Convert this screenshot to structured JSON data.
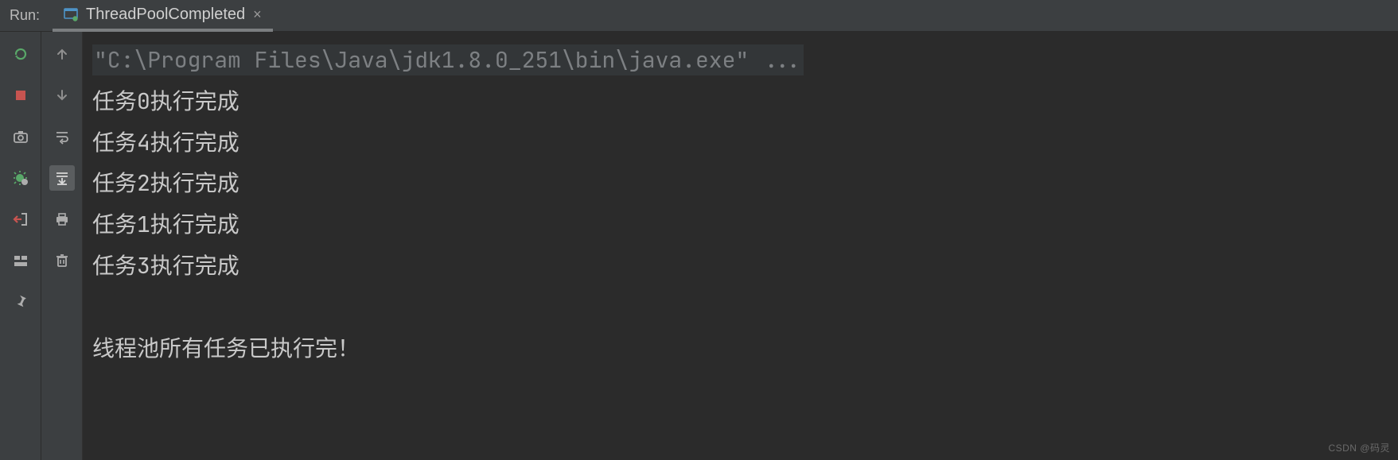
{
  "header": {
    "run_label": "Run:",
    "tab_title": "ThreadPoolCompleted",
    "close_glyph": "×"
  },
  "toolbar_primary": [
    {
      "name": "rerun-button"
    },
    {
      "name": "stop-button"
    },
    {
      "name": "dump-threads-button"
    },
    {
      "name": "profile-button"
    },
    {
      "name": "exit-button"
    },
    {
      "name": "layout-button"
    },
    {
      "name": "pin-button"
    }
  ],
  "toolbar_secondary": [
    {
      "name": "scroll-up-button"
    },
    {
      "name": "scroll-down-button"
    },
    {
      "name": "soft-wrap-button"
    },
    {
      "name": "scroll-to-end-button"
    },
    {
      "name": "print-button"
    },
    {
      "name": "clear-all-button"
    }
  ],
  "console": {
    "command_line": "\"C:\\Program Files\\Java\\jdk1.8.0_251\\bin\\java.exe\" ...",
    "output_lines": [
      "任务0执行完成",
      "任务4执行完成",
      "任务2执行完成",
      "任务1执行完成",
      "任务3执行完成",
      "",
      "线程池所有任务已执行完！"
    ]
  },
  "watermark": "CSDN @码灵"
}
